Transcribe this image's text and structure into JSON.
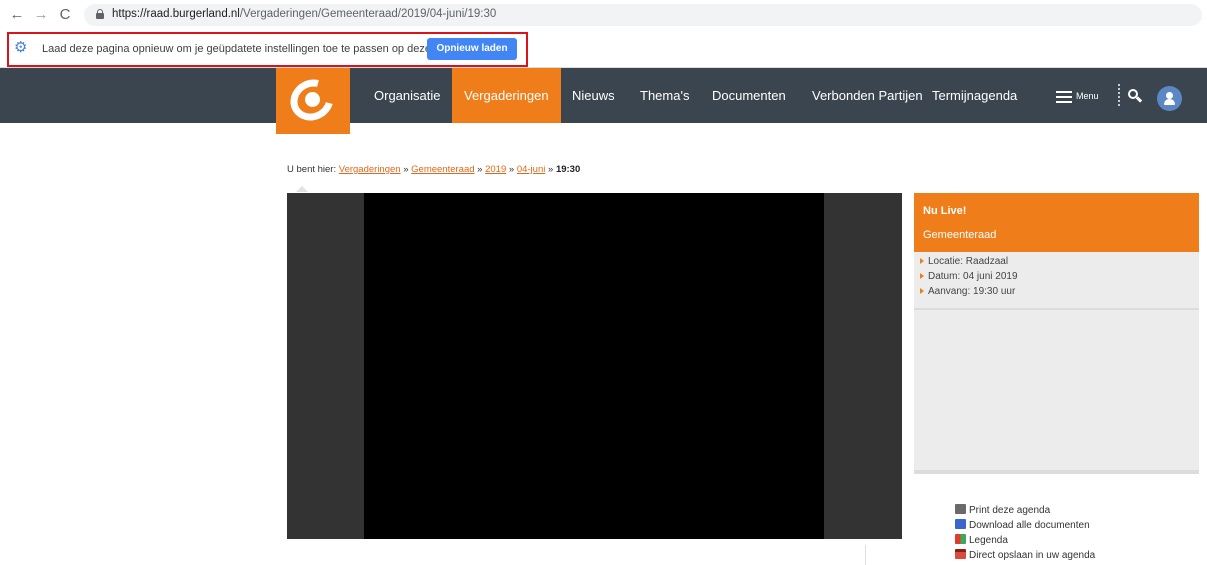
{
  "browser": {
    "url_host": "https://raad.burgerland.nl",
    "url_path": "/Vergaderingen/Gemeenteraad/2019/04-juni/19:30"
  },
  "infobar": {
    "message": "Laad deze pagina opnieuw om je geüpdatete instellingen toe te passen op deze site",
    "button_label": "Opnieuw laden"
  },
  "nav": {
    "items": [
      "Organisatie",
      "Vergaderingen",
      "Nieuws",
      "Thema's",
      "Documenten",
      "Verbonden Partijen",
      "Termijnagenda"
    ],
    "active": "Vergaderingen",
    "menu_label": "Menu"
  },
  "breadcrumb": {
    "prefix": "U bent hier:",
    "links": [
      "Vergaderingen",
      "Gemeenteraad",
      "2019",
      "04-juni"
    ],
    "separator": "»",
    "current": "19:30"
  },
  "live": {
    "title": "Nu Live!",
    "subtitle": "Gemeenteraad",
    "details": [
      "Locatie: Raadzaal",
      "Datum: 04 juni 2019",
      "Aanvang: 19:30 uur"
    ]
  },
  "links": {
    "print": "Print deze agenda",
    "download": "Download alle documenten",
    "legend": "Legenda",
    "calendar": "Direct opslaan in uw agenda"
  },
  "colors": {
    "accent": "#ee7d1a",
    "nav_bg": "#3b4550",
    "chrome_button": "#4285f4",
    "highlight_box": "#d9141b"
  }
}
